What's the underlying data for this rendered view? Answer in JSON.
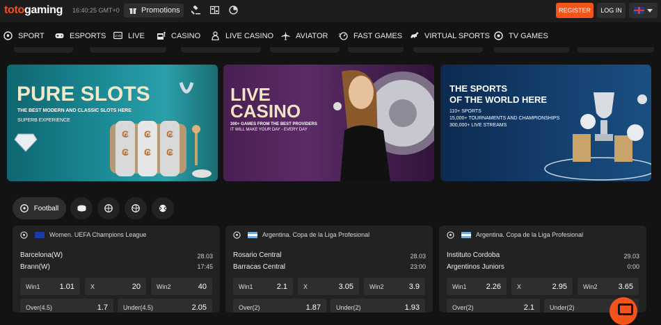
{
  "header": {
    "logo": {
      "prefix": "toto",
      "suffix": "gaming"
    },
    "clock": "16:40:25  GMT+0",
    "promotions_label": "Promotions",
    "register_label": "REGISTER",
    "login_label": "LOG IN",
    "language_icon": "uk-flag-icon"
  },
  "nav": [
    {
      "label": "SPORT",
      "icon": "soccer-ball-icon"
    },
    {
      "label": "ESPORTS",
      "icon": "gamepad-icon"
    },
    {
      "label": "LIVE",
      "icon": "live-tv-icon"
    },
    {
      "label": "CASINO",
      "icon": "slot-machine-icon"
    },
    {
      "label": "LIVE CASINO",
      "icon": "dealer-icon"
    },
    {
      "label": "AVIATOR",
      "icon": "airplane-icon"
    },
    {
      "label": "FAST GAMES",
      "icon": "speed-icon"
    },
    {
      "label": "VIRTUAL SPORTS",
      "icon": "horse-icon"
    },
    {
      "label": "TV GAMES",
      "icon": "tv-ball-icon"
    }
  ],
  "banners": [
    {
      "title": "PURE SLOTS",
      "line1": "THE BEST MODERN AND CLASSIC SLOTS HERE",
      "line2": "SUPERB EXPERIENCE"
    },
    {
      "title1": "LIVE",
      "title2": "CASINO",
      "line1": "300+ GAMES FROM THE BEST PROVIDERS",
      "line2": "IT WILL MAKE YOUR DAY - EVERY DAY"
    },
    {
      "title1": "THE SPORTS",
      "title2": "OF THE WORLD HERE",
      "line1": "110+ SPORTS",
      "line2": "15,000+ TOURNAMENTS AND CHAMPIONSHIPS",
      "line3": "300,000+ LIVE STREAMS"
    }
  ],
  "sport_tabs": {
    "active_label": "Football",
    "icons": [
      "football-icon",
      "ice-hockey-icon",
      "basketball-icon",
      "volleyball-icon",
      "tennis-icon"
    ]
  },
  "matches": [
    {
      "league": "Women. UEFA Champions League",
      "flag": "eu",
      "home": "Barcelona(W)",
      "away": "Brann(W)",
      "date": "28.03",
      "time": "17:45",
      "odds": [
        {
          "label": "Win1",
          "value": "1.01"
        },
        {
          "label": "X",
          "value": "20"
        },
        {
          "label": "Win2",
          "value": "40"
        }
      ],
      "totals": [
        {
          "label": "Over(4.5)",
          "value": "1.7"
        },
        {
          "label": "Under(4.5)",
          "value": "2.05"
        }
      ]
    },
    {
      "league": "Argentina. Copa de la Liga Profesional",
      "flag": "ar",
      "home": "Rosario Central",
      "away": "Barracas Central",
      "date": "28.03",
      "time": "23:00",
      "odds": [
        {
          "label": "Win1",
          "value": "2.1"
        },
        {
          "label": "X",
          "value": "3.05"
        },
        {
          "label": "Win2",
          "value": "3.9"
        }
      ],
      "totals": [
        {
          "label": "Over(2)",
          "value": "1.87"
        },
        {
          "label": "Under(2)",
          "value": "1.93"
        }
      ]
    },
    {
      "league": "Argentina. Copa de la Liga Profesional",
      "flag": "ar",
      "home": "Instituto Cordoba",
      "away": "Argentinos Juniors",
      "date": "29.03",
      "time": "0:00",
      "odds": [
        {
          "label": "Win1",
          "value": "2.26"
        },
        {
          "label": "X",
          "value": "2.95"
        },
        {
          "label": "Win2",
          "value": "3.65"
        }
      ],
      "totals": [
        {
          "label": "Over(2)",
          "value": "2.1"
        },
        {
          "label": "Under(2)",
          "value": ""
        }
      ]
    }
  ],
  "colors": {
    "accent": "#f2541c",
    "bg": "#131313",
    "card": "#222222"
  }
}
